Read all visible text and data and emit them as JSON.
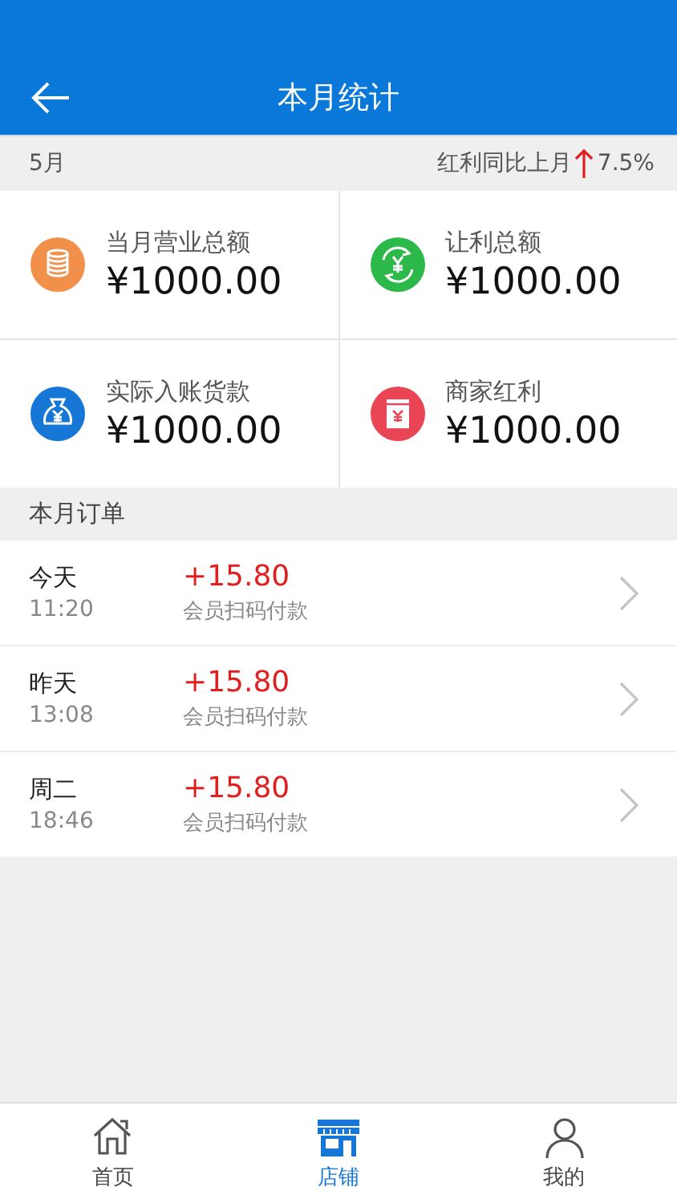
{
  "header": {
    "title": "本月统计"
  },
  "summary": {
    "month": "5月",
    "trend_label": "红利同比上月",
    "trend_value": "7.5%"
  },
  "stats": [
    {
      "label": "当月营业总额",
      "value": "¥1000.00",
      "kind": "coins",
      "color": "#f0904a"
    },
    {
      "label": "让利总额",
      "value": "¥1000.00",
      "kind": "exchange",
      "color": "#2db84a"
    },
    {
      "label": "实际入账货款",
      "value": "¥1000.00",
      "kind": "bag",
      "color": "#1677d6"
    },
    {
      "label": "商家红利",
      "value": "¥1000.00",
      "kind": "packet",
      "color": "#e94555"
    }
  ],
  "orders_section": {
    "title": "本月订单"
  },
  "orders": [
    {
      "day": "今天",
      "time": "11:20",
      "amount": "+15.80",
      "description": "会员扫码付款"
    },
    {
      "day": "昨天",
      "time": "13:08",
      "amount": "+15.80",
      "description": "会员扫码付款"
    },
    {
      "day": "周二",
      "time": "18:46",
      "amount": "+15.80",
      "description": "会员扫码付款"
    }
  ],
  "tabs": [
    {
      "label": "首页",
      "kind": "home",
      "selected": false
    },
    {
      "label": "店铺",
      "kind": "store",
      "selected": true
    },
    {
      "label": "我的",
      "kind": "person",
      "selected": false
    }
  ]
}
